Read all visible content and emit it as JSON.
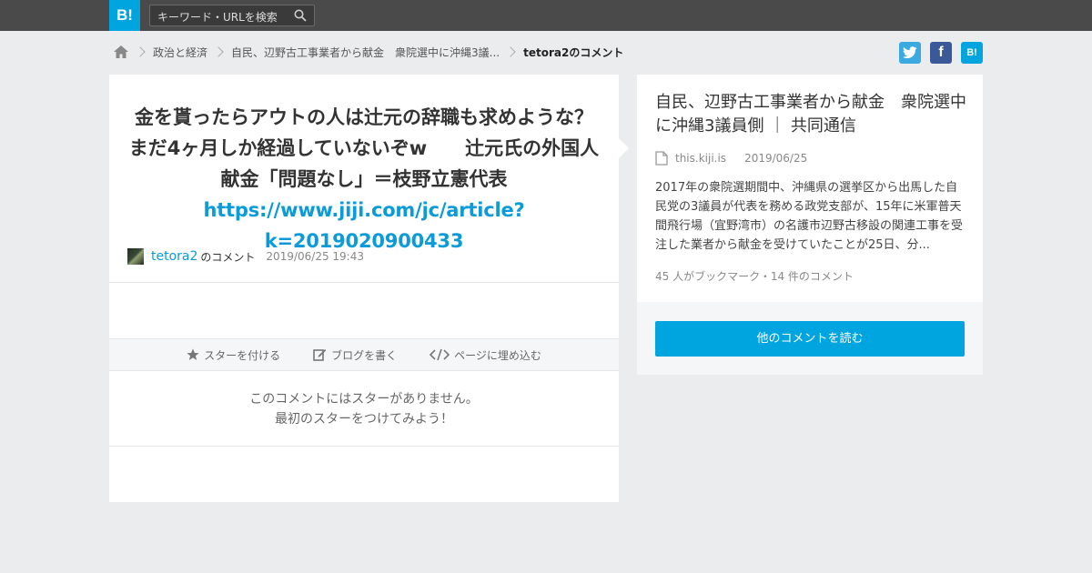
{
  "header": {
    "logo": "B!",
    "search_placeholder": "キーワード・URLを検索"
  },
  "breadcrumb": {
    "items": [
      "政治と経済",
      "自民、辺野古工事業者から献金　衆院選中に沖縄3議...",
      "tetora2のコメント"
    ]
  },
  "share": {
    "twitter": "t",
    "facebook": "f",
    "hatena": "B!"
  },
  "comment": {
    "text": "金を貰ったらアウトの人は辻元の辞職も求めような？まだ4ヶ月しか経過していないぞw　　辻元氏の外国人献金「問題なし」＝枝野立憲代表",
    "link": "https://www.jiji.com/jc/article?k=2019020900433",
    "author": "tetora2",
    "author_suffix": "のコメント",
    "date": "2019/06/25 19:43"
  },
  "actions": {
    "star": "スターを付ける",
    "blog": "ブログを書く",
    "embed": "ページに埋め込む"
  },
  "stars": {
    "line1": "このコメントにはスターがありません。",
    "line2": "最初のスターをつけてみよう！"
  },
  "entry": {
    "title": "自民、辺野古工事業者から献金　衆院選中に沖縄3議員側 ｜ 共同通信",
    "domain": "this.kiji.is",
    "date": "2019/06/25",
    "summary": "2017年の衆院選期間中、沖縄県の選挙区から出馬した自民党の3議員が代表を務める政党支部が、15年に米軍普天間飛行場（宜野湾市）の名護市辺野古移設の関連工事を受注した業者から献金を受けていたことが25日、分...",
    "counts": "45 人がブックマーク・14 件のコメント",
    "read_more": "他のコメントを読む"
  },
  "colors": {
    "accent": "#00a4de",
    "link": "#0a9bd8"
  }
}
